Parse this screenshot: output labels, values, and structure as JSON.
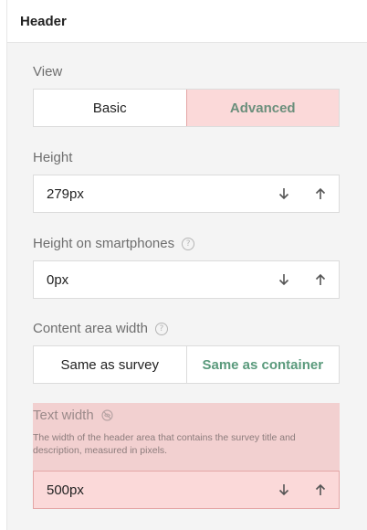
{
  "panel": {
    "title": "Header"
  },
  "view": {
    "label": "View",
    "options": [
      "Basic",
      "Advanced"
    ],
    "selected": "Advanced"
  },
  "height": {
    "label": "Height",
    "value": "279px"
  },
  "height_smartphones": {
    "label": "Height on smartphones",
    "value": "0px"
  },
  "content_area_width": {
    "label": "Content area width",
    "options": [
      "Same as survey",
      "Same as container"
    ],
    "selected": "Same as container"
  },
  "text_width": {
    "label": "Text width",
    "description": "The width of the header area that contains the survey title and description, measured in pixels.",
    "value": "500px"
  },
  "colors": {
    "accent_green": "#5a9a7c",
    "highlight_pink": "#fbd9d9"
  },
  "icons": [
    "help-icon",
    "arrow-down-icon",
    "arrow-up-icon",
    "visibility-off-icon"
  ]
}
